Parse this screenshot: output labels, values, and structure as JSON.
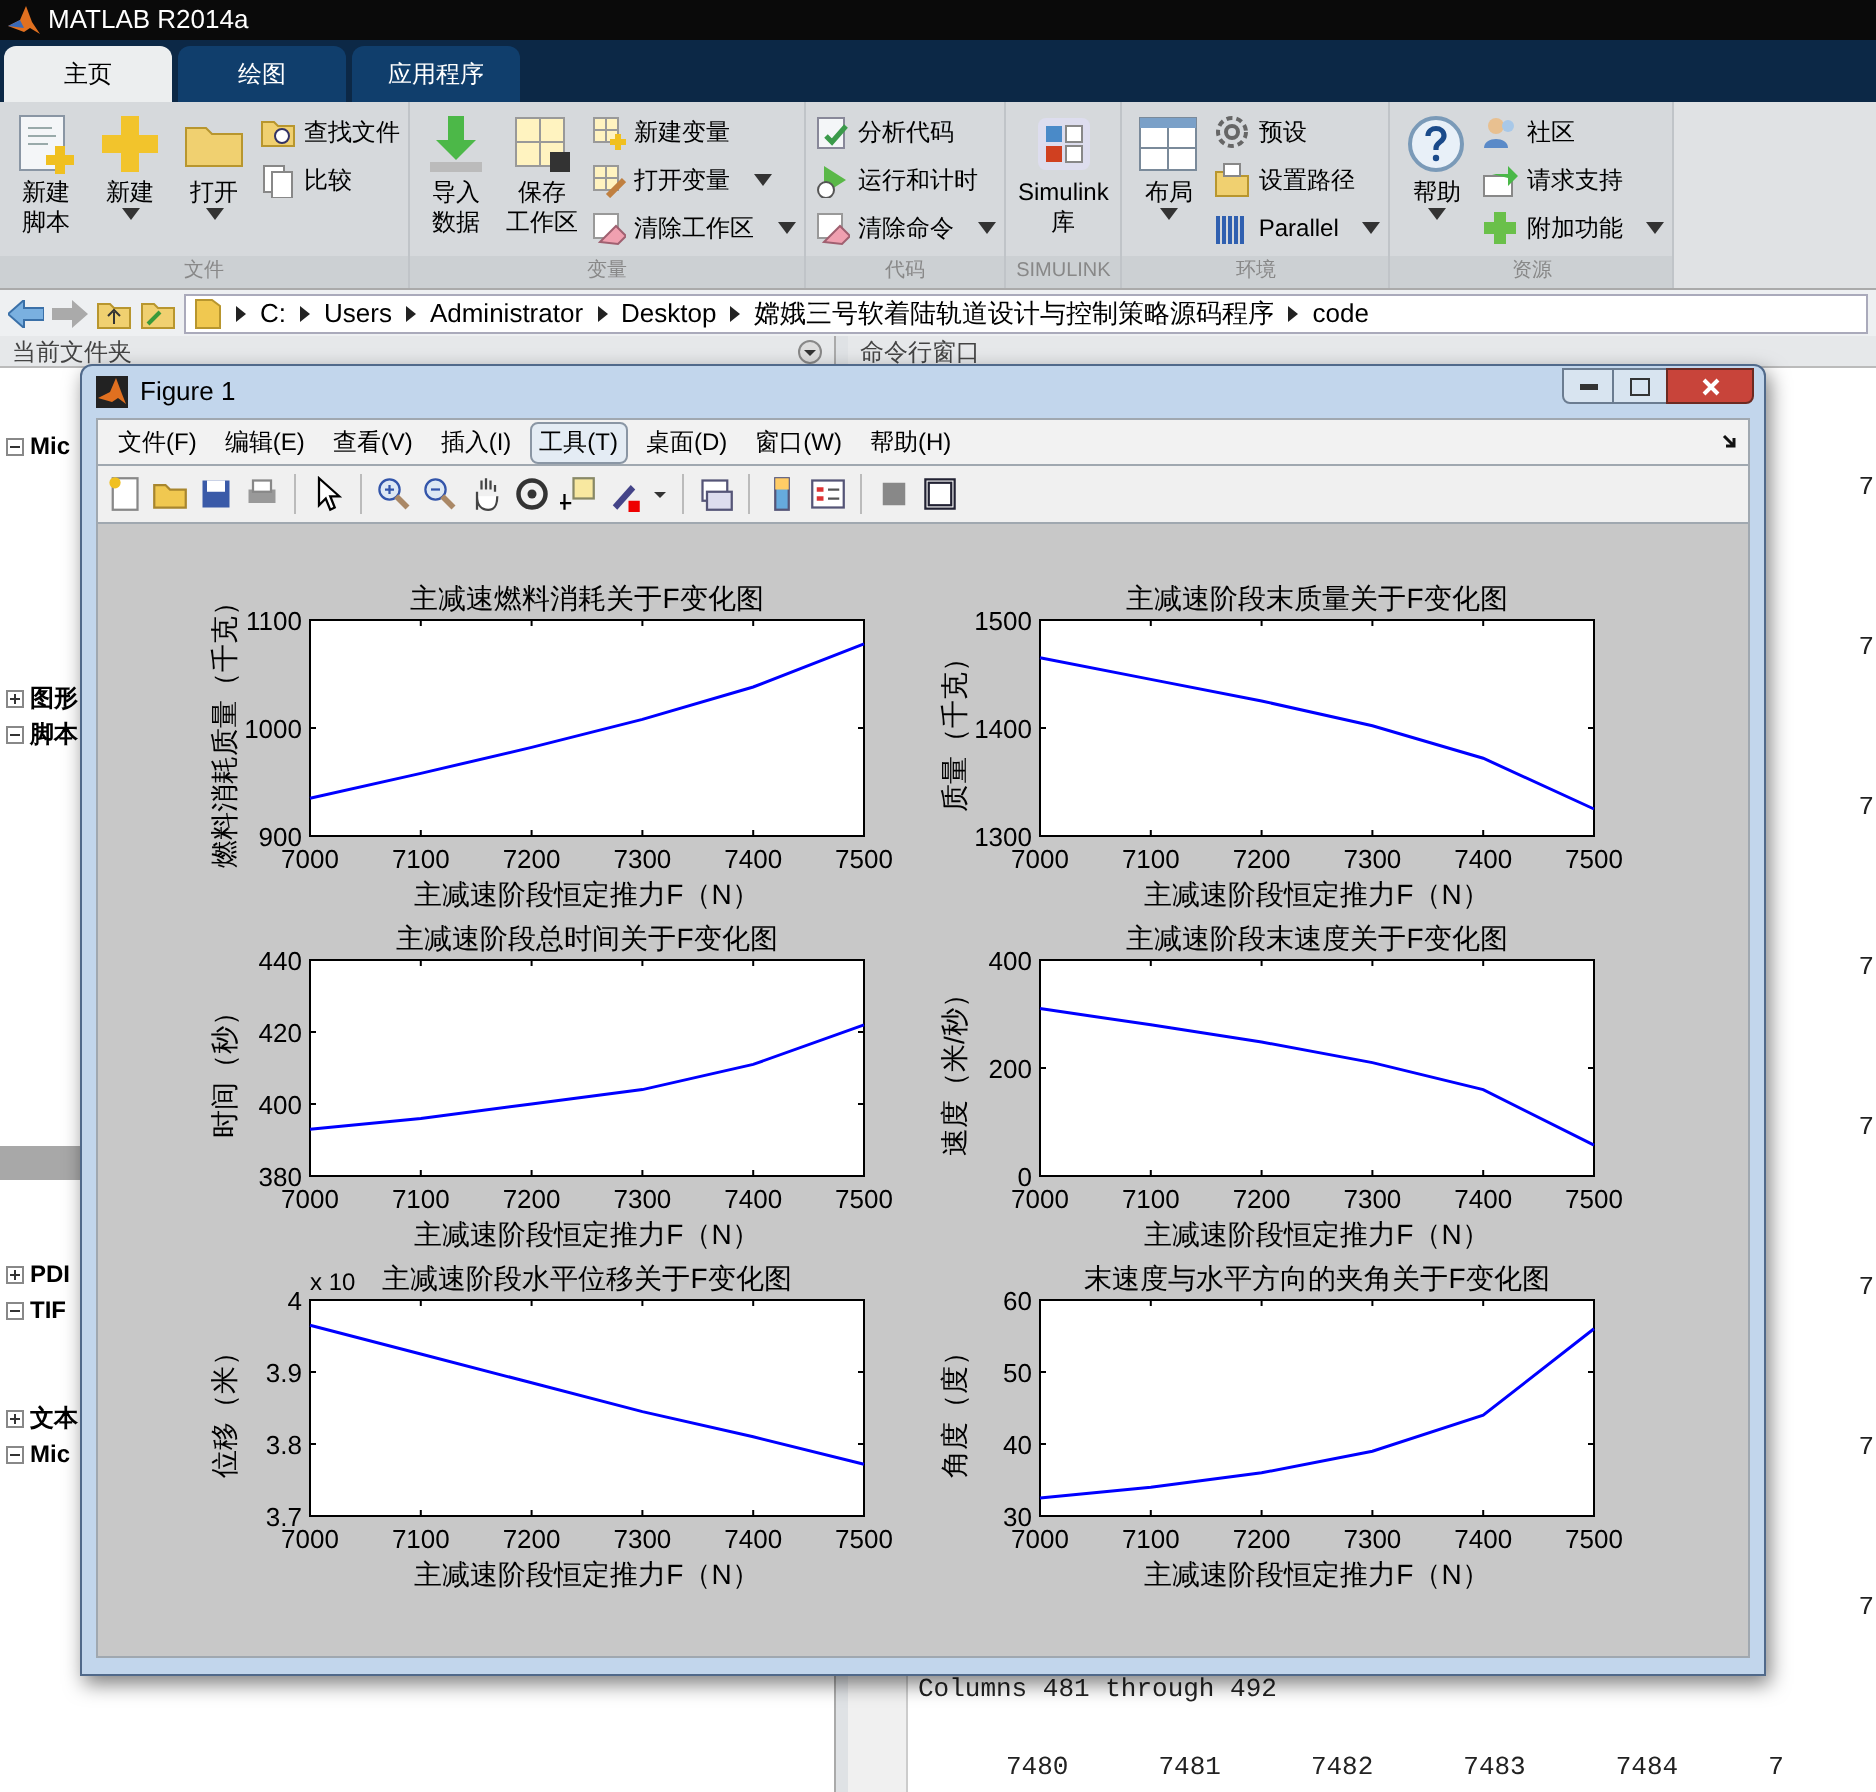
{
  "app_title": "MATLAB R2014a",
  "tabs": [
    {
      "label": "主页",
      "selected": true
    },
    {
      "label": "绘图",
      "selected": false
    },
    {
      "label": "应用程序",
      "selected": false
    }
  ],
  "ribbon": {
    "groups": [
      {
        "label": "文件",
        "large_buttons": [
          {
            "label_lines": [
              "新建",
              "脚本"
            ],
            "has_menu": false
          },
          {
            "label_lines": [
              "新建"
            ],
            "has_menu": true
          },
          {
            "label_lines": [
              "打开"
            ],
            "has_menu": true
          }
        ],
        "small_buttons": [
          {
            "label": "查找文件",
            "has_menu": false
          },
          {
            "label": "比较",
            "has_menu": false
          }
        ]
      },
      {
        "label": "变量",
        "large_buttons": [
          {
            "label_lines": [
              "导入",
              "数据"
            ],
            "has_menu": false
          },
          {
            "label_lines": [
              "保存",
              "工作区"
            ],
            "has_menu": false
          }
        ],
        "small_buttons": [
          {
            "label": "新建变量",
            "has_menu": false
          },
          {
            "label": "打开变量",
            "has_menu": true
          },
          {
            "label": "清除工作区",
            "has_menu": true
          }
        ]
      },
      {
        "label": "代码",
        "small_buttons": [
          {
            "label": "分析代码",
            "has_menu": false
          },
          {
            "label": "运行和计时",
            "has_menu": false
          },
          {
            "label": "清除命令",
            "has_menu": true
          }
        ]
      },
      {
        "label": "SIMULINK",
        "large_buttons": [
          {
            "label_lines": [
              "Simulink",
              "库"
            ],
            "has_menu": false
          }
        ]
      },
      {
        "label": "环境",
        "large_buttons": [
          {
            "label_lines": [
              "布局"
            ],
            "has_menu": true
          }
        ],
        "small_buttons": [
          {
            "label": "预设",
            "has_menu": false
          },
          {
            "label": "设置路径",
            "has_menu": false
          },
          {
            "label": "Parallel",
            "has_menu": true
          }
        ]
      },
      {
        "label": "资源",
        "large_buttons": [
          {
            "label_lines": [
              "帮助"
            ],
            "has_menu": true
          }
        ],
        "small_buttons": [
          {
            "label": "社区",
            "has_menu": false
          },
          {
            "label": "请求支持",
            "has_menu": false
          },
          {
            "label": "附加功能",
            "has_menu": true
          }
        ]
      }
    ]
  },
  "address_bar": {
    "segments": [
      "C:",
      "Users",
      "Administrator",
      "Desktop",
      "嫦娥三号软着陆轨道设计与控制策略源码程序",
      "code"
    ]
  },
  "current_folder": {
    "title": "当前文件夹",
    "items": [
      {
        "label": "Mic",
        "expanded": true
      },
      {
        "label": "图形",
        "expanded": false
      },
      {
        "label": "脚本",
        "expanded": true
      },
      {
        "label": "PDI",
        "expanded": false
      },
      {
        "label": "TIF",
        "expanded": true
      },
      {
        "label": "文本",
        "expanded": false
      },
      {
        "label": "Mic",
        "expanded": true
      }
    ]
  },
  "command_window": {
    "title": "命令行窗口",
    "edge_values": [
      "7",
      "7",
      "7",
      "7",
      "7",
      "7",
      "7",
      "7"
    ],
    "columns_header": "Columns 481 through 492",
    "row_values": [
      "7480",
      "7481",
      "7482",
      "7483",
      "7484",
      "7"
    ]
  },
  "figure": {
    "title": "Figure 1",
    "menu": [
      {
        "label": "文件(F)",
        "selected": false
      },
      {
        "label": "编辑(E)",
        "selected": false
      },
      {
        "label": "查看(V)",
        "selected": false
      },
      {
        "label": "插入(I)",
        "selected": false
      },
      {
        "label": "工具(T)",
        "selected": true
      },
      {
        "label": "桌面(D)",
        "selected": false
      },
      {
        "label": "窗口(W)",
        "selected": false
      },
      {
        "label": "帮助(H)",
        "selected": false
      }
    ],
    "plots": [
      {
        "chart_data": {
          "type": "line",
          "title": "主减速燃料消耗关于F变化图",
          "xlabel": "主减速阶段恒定推力F（N）",
          "ylabel": "燃料消耗质量（千克）",
          "x": [
            7000,
            7100,
            7200,
            7300,
            7400,
            7500
          ],
          "series": [
            {
              "color": "#0000ff",
              "values": [
                935,
                958,
                982,
                1008,
                1038,
                1078
              ]
            }
          ],
          "xlim": [
            7000,
            7500
          ],
          "ylim": [
            900,
            1100
          ],
          "xticks": [
            7000,
            7100,
            7200,
            7300,
            7400,
            7500
          ],
          "yticks": [
            900,
            1000,
            1100
          ]
        }
      },
      {
        "chart_data": {
          "type": "line",
          "title": "主减速阶段末质量关于F变化图",
          "xlabel": "主减速阶段恒定推力F（N）",
          "ylabel": "质量（千克）",
          "x": [
            7000,
            7100,
            7200,
            7300,
            7400,
            7500
          ],
          "series": [
            {
              "color": "#0000ff",
              "values": [
                1465,
                1445,
                1425,
                1402,
                1372,
                1325
              ]
            }
          ],
          "xlim": [
            7000,
            7500
          ],
          "ylim": [
            1300,
            1500
          ],
          "xticks": [
            7000,
            7100,
            7200,
            7300,
            7400,
            7500
          ],
          "yticks": [
            1300,
            1400,
            1500
          ]
        }
      },
      {
        "chart_data": {
          "type": "line",
          "title": "主减速阶段总时间关于F变化图",
          "xlabel": "主减速阶段恒定推力F（N）",
          "ylabel": "时间（秒）",
          "x": [
            7000,
            7100,
            7200,
            7300,
            7400,
            7500
          ],
          "series": [
            {
              "color": "#0000ff",
              "values": [
                393,
                396,
                400,
                404,
                411,
                422
              ]
            }
          ],
          "xlim": [
            7000,
            7500
          ],
          "ylim": [
            380,
            440
          ],
          "xticks": [
            7000,
            7100,
            7200,
            7300,
            7400,
            7500
          ],
          "yticks": [
            380,
            400,
            420,
            440
          ]
        }
      },
      {
        "chart_data": {
          "type": "line",
          "title": "主减速阶段末速度关于F变化图",
          "xlabel": "主减速阶段恒定推力F（N）",
          "ylabel": "速度（米/秒）",
          "x": [
            7000,
            7100,
            7200,
            7300,
            7400,
            7500
          ],
          "series": [
            {
              "color": "#0000ff",
              "values": [
                310,
                280,
                248,
                210,
                160,
                57
              ]
            }
          ],
          "xlim": [
            7000,
            7500
          ],
          "ylim": [
            0,
            400
          ],
          "xticks": [
            7000,
            7100,
            7200,
            7300,
            7400,
            7500
          ],
          "yticks": [
            0,
            200,
            400
          ]
        }
      },
      {
        "multiplier": "x 10",
        "chart_data": {
          "type": "line",
          "title": "主减速阶段水平位移关于F变化图",
          "xlabel": "主减速阶段恒定推力F（N）",
          "ylabel": "位移（米）",
          "x": [
            7000,
            7100,
            7200,
            7300,
            7400,
            7500
          ],
          "series": [
            {
              "color": "#0000ff",
              "values": [
                3.965,
                3.925,
                3.885,
                3.845,
                3.81,
                3.772
              ]
            }
          ],
          "xlim": [
            7000,
            7500
          ],
          "ylim": [
            3.7,
            4
          ],
          "xticks": [
            7000,
            7100,
            7200,
            7300,
            7400,
            7500
          ],
          "yticks": [
            3.7,
            3.8,
            3.9,
            4
          ]
        }
      },
      {
        "chart_data": {
          "type": "line",
          "title": "末速度与水平方向的夹角关于F变化图",
          "xlabel": "主减速阶段恒定推力F（N）",
          "ylabel": "角度（度）",
          "x": [
            7000,
            7100,
            7200,
            7300,
            7400,
            7500
          ],
          "series": [
            {
              "color": "#0000ff",
              "values": [
                32.5,
                34,
                36,
                39,
                44,
                56
              ]
            }
          ],
          "xlim": [
            7000,
            7500
          ],
          "ylim": [
            30,
            60
          ],
          "xticks": [
            7000,
            7100,
            7200,
            7300,
            7400,
            7500
          ],
          "yticks": [
            30,
            40,
            50,
            60
          ]
        }
      }
    ]
  }
}
